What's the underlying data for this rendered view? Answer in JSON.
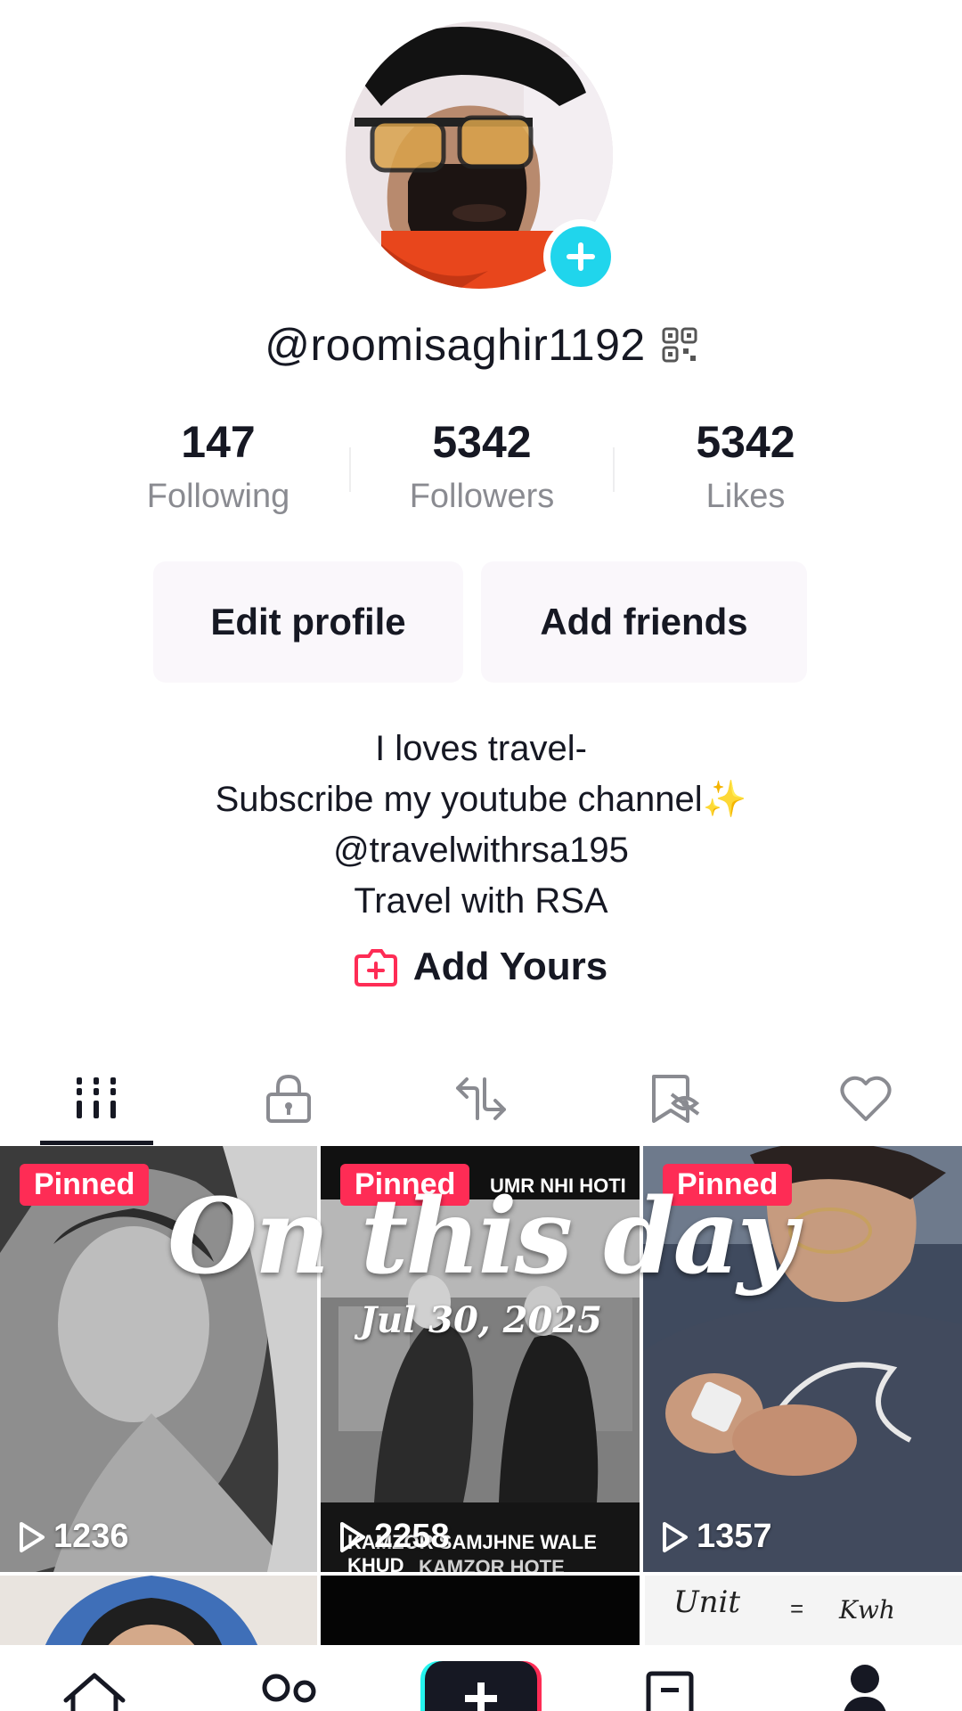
{
  "profile": {
    "username": "@roomisaghir1192",
    "stats": [
      {
        "value": "147",
        "label": "Following"
      },
      {
        "value": "5342",
        "label": "Followers"
      },
      {
        "value": "5342",
        "label": "Likes"
      }
    ],
    "edit_profile_label": "Edit profile",
    "add_friends_label": "Add friends",
    "bio_lines": [
      "I loves travel-",
      "Subscribe my youtube channel✨",
      "@travelwithrsa195",
      "Travel with RSA"
    ],
    "add_yours_label": "Add Yours"
  },
  "tabs": [
    "videos-icon",
    "lock-icon",
    "repost-icon",
    "bookmark-icon",
    "heart-icon"
  ],
  "overlay": {
    "title": "On this day",
    "date": "Jul 30, 2025"
  },
  "videos": [
    {
      "pinned": "Pinned",
      "views": "1236"
    },
    {
      "pinned": "Pinned",
      "views": "2258",
      "caption_top": "UMR NHI HOTI",
      "caption_bottom": "KAMZOR SAMJHNE WALE KHUD",
      "caption_bottom2": "KAMZOR HOTE"
    },
    {
      "pinned": "Pinned",
      "views": "1357"
    }
  ],
  "second_row": {
    "tile3_text_left": "Unit",
    "tile3_text_mid": "=",
    "tile3_text_right": "Kwh"
  },
  "colors": {
    "accent": "#fe2c55",
    "avatar_add": "#20d5ec",
    "muted": "#8a8b91"
  }
}
